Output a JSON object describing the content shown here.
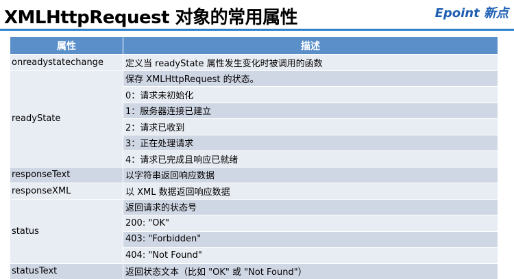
{
  "title": "XMLHttpRequest 对象的常用属性",
  "logo": "Epoint 新点",
  "headers": {
    "attribute": "属性",
    "description": "描述"
  },
  "rows": [
    {
      "name": "onreadystatechange",
      "descs": [
        "定义当 readyState 属性发生变化时被调用的函数"
      ]
    },
    {
      "name": "readyState",
      "descs": [
        "保存 XMLHttpRequest 的状态。",
        "0：请求未初始化",
        "1：服务器连接已建立",
        "2：请求已收到",
        "3：正在处理请求",
        "4：请求已完成且响应已就绪"
      ]
    },
    {
      "name": "responseText",
      "descs": [
        "以字符串返回响应数据"
      ]
    },
    {
      "name": "responseXML",
      "descs": [
        "以 XML 数据返回响应数据"
      ]
    },
    {
      "name": "status",
      "descs": [
        "返回请求的状态号",
        "200: \"OK\"",
        "403: \"Forbidden\"",
        "404: \"Not Found\""
      ]
    },
    {
      "name": "statusText",
      "descs": [
        "返回状态文本（比如 \"OK\" 或 \"Not Found\"）"
      ]
    }
  ]
}
